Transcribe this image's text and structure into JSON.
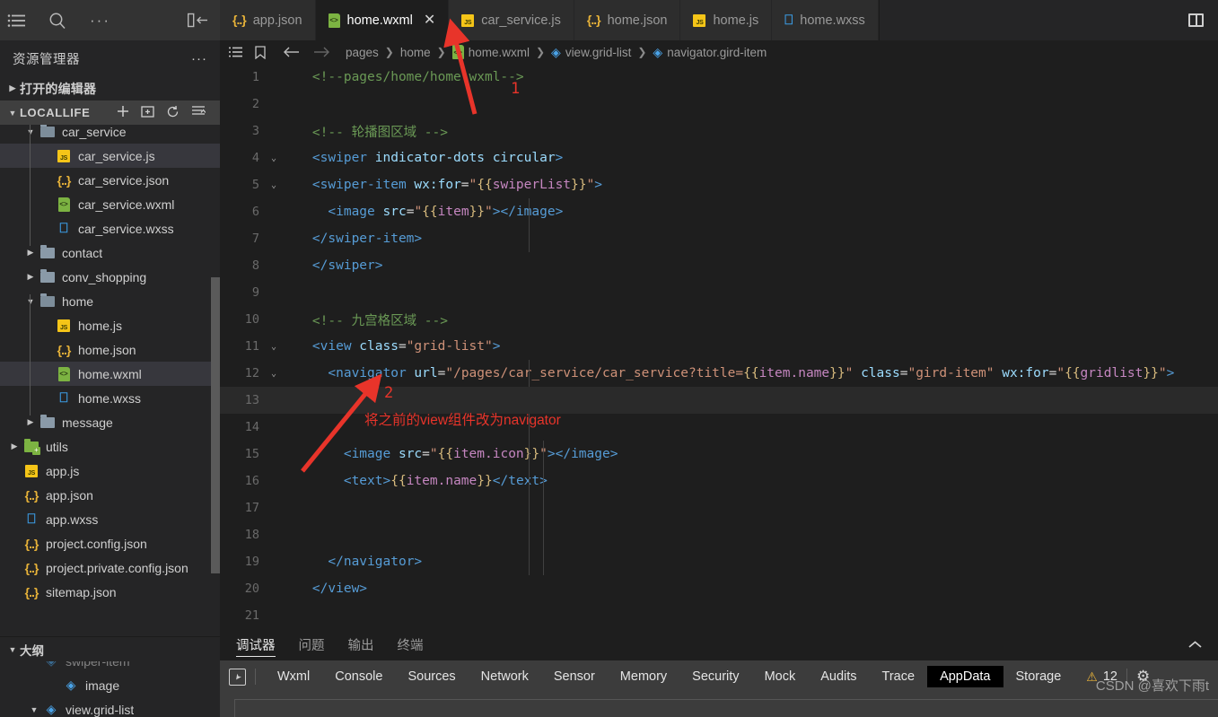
{
  "activity_bar": {
    "icons": [
      "menu-icon",
      "search-icon",
      "more-icon",
      "collapse-sidebar-icon"
    ]
  },
  "sidebar": {
    "title": "资源管理器",
    "more_label": "···",
    "open_editors": "打开的编辑器",
    "project": {
      "name": "LOCALLIFE",
      "actions": [
        "new-file-icon",
        "new-folder-icon",
        "refresh-icon",
        "collapse-all-icon"
      ]
    },
    "tree": [
      {
        "label": "car_service",
        "type": "folder-open",
        "depth": 1,
        "twisty": "down",
        "selected": false
      },
      {
        "label": "car_service.js",
        "type": "js",
        "depth": 2,
        "twisty": "",
        "selected": true
      },
      {
        "label": "car_service.json",
        "type": "json",
        "depth": 2,
        "twisty": "",
        "selected": false
      },
      {
        "label": "car_service.wxml",
        "type": "wxml",
        "depth": 2,
        "twisty": "",
        "selected": false
      },
      {
        "label": "car_service.wxss",
        "type": "wxss",
        "depth": 2,
        "twisty": "",
        "selected": false
      },
      {
        "label": "contact",
        "type": "folder",
        "depth": 1,
        "twisty": "right",
        "selected": false
      },
      {
        "label": "conv_shopping",
        "type": "folder",
        "depth": 1,
        "twisty": "right",
        "selected": false
      },
      {
        "label": "home",
        "type": "folder-open",
        "depth": 1,
        "twisty": "down",
        "selected": false
      },
      {
        "label": "home.js",
        "type": "js",
        "depth": 2,
        "twisty": "",
        "selected": false
      },
      {
        "label": "home.json",
        "type": "json",
        "depth": 2,
        "twisty": "",
        "selected": false
      },
      {
        "label": "home.wxml",
        "type": "wxml",
        "depth": 2,
        "twisty": "",
        "selected": true
      },
      {
        "label": "home.wxss",
        "type": "wxss",
        "depth": 2,
        "twisty": "",
        "selected": false
      },
      {
        "label": "message",
        "type": "folder",
        "depth": 1,
        "twisty": "right",
        "selected": false
      },
      {
        "label": "utils",
        "type": "folder-green",
        "depth": 0,
        "twisty": "right",
        "selected": false
      },
      {
        "label": "app.js",
        "type": "js",
        "depth": 0,
        "twisty": "",
        "selected": false
      },
      {
        "label": "app.json",
        "type": "json",
        "depth": 0,
        "twisty": "",
        "selected": false
      },
      {
        "label": "app.wxss",
        "type": "wxss",
        "depth": 0,
        "twisty": "",
        "selected": false
      },
      {
        "label": "project.config.json",
        "type": "json",
        "depth": 0,
        "twisty": "",
        "selected": false
      },
      {
        "label": "project.private.config.json",
        "type": "json",
        "depth": 0,
        "twisty": "",
        "selected": false
      },
      {
        "label": "sitemap.json",
        "type": "json",
        "depth": 0,
        "twisty": "",
        "selected": false
      }
    ],
    "outline": {
      "title": "大纲",
      "items": [
        {
          "label": "swiper-item",
          "type": "node",
          "depth": 1,
          "twisty": "",
          "clipped": true
        },
        {
          "label": "image",
          "type": "node",
          "depth": 2,
          "twisty": ""
        },
        {
          "label": "view.grid-list",
          "type": "node",
          "depth": 1,
          "twisty": "down"
        }
      ]
    }
  },
  "tabs": [
    {
      "label": "app.json",
      "type": "json",
      "active": false,
      "closable": false
    },
    {
      "label": "home.wxml",
      "type": "wxml",
      "active": true,
      "closable": true,
      "close_label": "✕"
    },
    {
      "label": "car_service.js",
      "type": "js",
      "active": false,
      "closable": false
    },
    {
      "label": "home.json",
      "type": "json",
      "active": false,
      "closable": false
    },
    {
      "label": "home.js",
      "type": "js",
      "active": false,
      "closable": false
    },
    {
      "label": "home.wxss",
      "type": "wxss",
      "active": false,
      "closable": false
    }
  ],
  "tabbar_actions": {
    "split_editor": "split-editor-icon"
  },
  "breadcrumb": {
    "icons": [
      "outline-list-icon",
      "bookmark-icon",
      "back-arrow-icon",
      "forward-arrow-icon"
    ],
    "items": [
      {
        "label": "pages",
        "icon": "",
        "color": "grey"
      },
      {
        "label": "home",
        "icon": "",
        "color": "grey"
      },
      {
        "label": "home.wxml",
        "icon": "wxml",
        "color": "grey"
      },
      {
        "label": "view.grid-list",
        "icon": "node",
        "color": "grey"
      },
      {
        "label": "navigator.gird-item",
        "icon": "node",
        "color": "grey"
      }
    ],
    "separator": "❯"
  },
  "editor": {
    "lines": [
      {
        "n": 1,
        "fold": "",
        "highlight": false,
        "tokens": [
          {
            "c": "t-com",
            "t": "    <!--pages/home/home.wxml-->"
          }
        ]
      },
      {
        "n": 2,
        "fold": "",
        "highlight": false,
        "tokens": []
      },
      {
        "n": 3,
        "fold": "",
        "highlight": false,
        "tokens": [
          {
            "c": "t-com",
            "t": "    <!-- 轮播图区域 -->"
          }
        ]
      },
      {
        "n": 4,
        "fold": "down",
        "highlight": false,
        "tokens": [
          {
            "c": "t-pun",
            "t": "    "
          },
          {
            "c": "t-tag",
            "t": "<swiper"
          },
          {
            "c": "t-attr",
            "t": " indicator-dots circular"
          },
          {
            "c": "t-tag",
            "t": ">"
          }
        ]
      },
      {
        "n": 5,
        "fold": "down",
        "highlight": false,
        "tokens": [
          {
            "c": "t-pun",
            "t": "    "
          },
          {
            "c": "t-tag",
            "t": "<swiper-item"
          },
          {
            "c": "t-attr",
            "t": " wx:for"
          },
          {
            "c": "t-pun",
            "t": "="
          },
          {
            "c": "t-str",
            "t": "\""
          },
          {
            "c": "t-brace",
            "t": "{{"
          },
          {
            "c": "t-var",
            "t": "swiperList"
          },
          {
            "c": "t-brace",
            "t": "}}"
          },
          {
            "c": "t-str",
            "t": "\""
          },
          {
            "c": "t-tag",
            "t": ">"
          }
        ]
      },
      {
        "n": 6,
        "fold": "",
        "highlight": false,
        "tokens": [
          {
            "c": "t-pun",
            "t": "      "
          },
          {
            "c": "t-tag",
            "t": "<image"
          },
          {
            "c": "t-attr",
            "t": " src"
          },
          {
            "c": "t-pun",
            "t": "="
          },
          {
            "c": "t-str",
            "t": "\""
          },
          {
            "c": "t-brace u",
            "t": "{{"
          },
          {
            "c": "t-var u",
            "t": "item"
          },
          {
            "c": "t-brace u",
            "t": "}}"
          },
          {
            "c": "t-str",
            "t": "\""
          },
          {
            "c": "t-tag",
            "t": "></image>"
          }
        ]
      },
      {
        "n": 7,
        "fold": "",
        "highlight": false,
        "tokens": [
          {
            "c": "t-pun",
            "t": "    "
          },
          {
            "c": "t-tag",
            "t": "</swiper-item>"
          }
        ]
      },
      {
        "n": 8,
        "fold": "",
        "highlight": false,
        "tokens": [
          {
            "c": "t-pun",
            "t": "    "
          },
          {
            "c": "t-tag",
            "t": "</swiper>"
          }
        ]
      },
      {
        "n": 9,
        "fold": "",
        "highlight": false,
        "tokens": []
      },
      {
        "n": 10,
        "fold": "",
        "highlight": false,
        "tokens": [
          {
            "c": "t-com",
            "t": "    <!-- 九宫格区域 -->"
          }
        ]
      },
      {
        "n": 11,
        "fold": "down",
        "highlight": false,
        "tokens": [
          {
            "c": "t-pun",
            "t": "    "
          },
          {
            "c": "t-tag",
            "t": "<view"
          },
          {
            "c": "t-attr",
            "t": " class"
          },
          {
            "c": "t-pun",
            "t": "="
          },
          {
            "c": "t-str",
            "t": "\"grid-list\""
          },
          {
            "c": "t-tag",
            "t": ">"
          }
        ]
      },
      {
        "n": 12,
        "fold": "down",
        "highlight": false,
        "tokens": [
          {
            "c": "t-pun",
            "t": "      "
          },
          {
            "c": "t-tag",
            "t": "<navigator"
          },
          {
            "c": "t-attr",
            "t": " url"
          },
          {
            "c": "t-pun",
            "t": "="
          },
          {
            "c": "t-str",
            "t": "\"/pages/car_service/car_service?title="
          },
          {
            "c": "t-brace",
            "t": "{{"
          },
          {
            "c": "t-var",
            "t": "item.name"
          },
          {
            "c": "t-brace",
            "t": "}}"
          },
          {
            "c": "t-str",
            "t": "\""
          },
          {
            "c": "t-attr",
            "t": " class"
          },
          {
            "c": "t-pun",
            "t": "="
          },
          {
            "c": "t-str",
            "t": "\"gird-item\""
          },
          {
            "c": "t-attr",
            "t": " wx:for"
          },
          {
            "c": "t-pun",
            "t": "="
          },
          {
            "c": "t-str",
            "t": "\""
          },
          {
            "c": "t-brace",
            "t": "{{"
          },
          {
            "c": "t-var",
            "t": "gridlist"
          },
          {
            "c": "t-brace",
            "t": "}}"
          },
          {
            "c": "t-str",
            "t": "\""
          },
          {
            "c": "t-tag",
            "t": ">"
          }
        ]
      },
      {
        "n": 13,
        "fold": "",
        "highlight": true,
        "tokens": []
      },
      {
        "n": 14,
        "fold": "",
        "highlight": false,
        "tokens": []
      },
      {
        "n": 15,
        "fold": "",
        "highlight": false,
        "tokens": [
          {
            "c": "t-pun",
            "t": "        "
          },
          {
            "c": "t-tag",
            "t": "<image"
          },
          {
            "c": "t-attr",
            "t": " src"
          },
          {
            "c": "t-pun",
            "t": "="
          },
          {
            "c": "t-str",
            "t": "\""
          },
          {
            "c": "t-brace u",
            "t": "{{"
          },
          {
            "c": "t-var u",
            "t": "item.icon"
          },
          {
            "c": "t-brace u",
            "t": "}}"
          },
          {
            "c": "t-str",
            "t": "\""
          },
          {
            "c": "t-tag",
            "t": "></image>"
          }
        ]
      },
      {
        "n": 16,
        "fold": "",
        "highlight": false,
        "tokens": [
          {
            "c": "t-pun",
            "t": "        "
          },
          {
            "c": "t-tag",
            "t": "<text>"
          },
          {
            "c": "t-brace",
            "t": "{{"
          },
          {
            "c": "t-var",
            "t": "item.name"
          },
          {
            "c": "t-brace",
            "t": "}}"
          },
          {
            "c": "t-tag",
            "t": "</text>"
          }
        ]
      },
      {
        "n": 17,
        "fold": "",
        "highlight": false,
        "tokens": []
      },
      {
        "n": 18,
        "fold": "",
        "highlight": false,
        "tokens": []
      },
      {
        "n": 19,
        "fold": "",
        "highlight": false,
        "tokens": [
          {
            "c": "t-pun",
            "t": "      "
          },
          {
            "c": "t-tag",
            "t": "</navigator>"
          }
        ]
      },
      {
        "n": 20,
        "fold": "",
        "highlight": false,
        "tokens": [
          {
            "c": "t-pun",
            "t": "    "
          },
          {
            "c": "t-tag",
            "t": "</view>"
          }
        ]
      },
      {
        "n": 21,
        "fold": "",
        "highlight": false,
        "tokens": []
      }
    ]
  },
  "annotations": [
    {
      "id": "ann1",
      "number": "1",
      "text": ""
    },
    {
      "id": "ann2",
      "number": "2",
      "text": "将之前的view组件改为navigator"
    }
  ],
  "panel": {
    "tabs": [
      {
        "label": "调试器",
        "active": true
      },
      {
        "label": "问题",
        "active": false
      },
      {
        "label": "输出",
        "active": false
      },
      {
        "label": "终端",
        "active": false
      }
    ],
    "collapse_icon": "chevron-up-icon"
  },
  "devtools": {
    "inspect_icon": "inspect-element-icon",
    "tabs": [
      {
        "label": "Wxml",
        "active": false
      },
      {
        "label": "Console",
        "active": false
      },
      {
        "label": "Sources",
        "active": false
      },
      {
        "label": "Network",
        "active": false
      },
      {
        "label": "Sensor",
        "active": false
      },
      {
        "label": "Memory",
        "active": false
      },
      {
        "label": "Security",
        "active": false
      },
      {
        "label": "Mock",
        "active": false
      },
      {
        "label": "Audits",
        "active": false
      },
      {
        "label": "Trace",
        "active": false
      },
      {
        "label": "AppData",
        "active": true
      },
      {
        "label": "Storage",
        "active": false
      }
    ],
    "warning_count": "12",
    "warning_icon": "warning-triangle-icon",
    "settings_icon": "gear-icon"
  },
  "watermark": "CSDN @喜欢下雨t",
  "colors": {
    "accent_red": "#e8342a",
    "tab_active_bg": "#1e1e1e",
    "editor_bg": "#1e1e1e",
    "sidebar_bg": "#252526",
    "panel_active_bg": "#000000"
  }
}
